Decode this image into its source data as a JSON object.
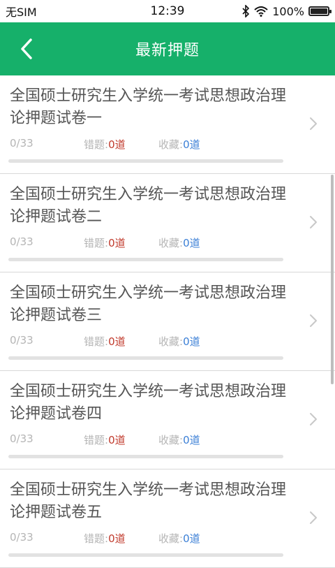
{
  "status_bar": {
    "carrier": "无SIM",
    "time": "12:39",
    "battery": "100%"
  },
  "header": {
    "title": "最新押题"
  },
  "exams": [
    {
      "title": "全国硕士研究生入学统一考试思想政治理论押题试卷一",
      "progress": "0/33",
      "progress_fraction": 0,
      "wrong_label": "错题:",
      "wrong_count": "0道",
      "fav_label": "收藏:",
      "fav_count": "0道"
    },
    {
      "title": "全国硕士研究生入学统一考试思想政治理论押题试卷二",
      "progress": "0/33",
      "progress_fraction": 0,
      "wrong_label": "错题:",
      "wrong_count": "0道",
      "fav_label": "收藏:",
      "fav_count": "0道"
    },
    {
      "title": "全国硕士研究生入学统一考试思想政治理论押题试卷三",
      "progress": "0/33",
      "progress_fraction": 0,
      "wrong_label": "错题:",
      "wrong_count": "0道",
      "fav_label": "收藏:",
      "fav_count": "0道"
    },
    {
      "title": "全国硕士研究生入学统一考试思想政治理论押题试卷四",
      "progress": "0/33",
      "progress_fraction": 0,
      "wrong_label": "错题:",
      "wrong_count": "0道",
      "fav_label": "收藏:",
      "fav_count": "0道"
    },
    {
      "title": "全国硕士研究生入学统一考试思想政治理论押题试卷五",
      "progress": "0/33",
      "progress_fraction": 0,
      "wrong_label": "错题:",
      "wrong_count": "0道",
      "fav_label": "收藏:",
      "fav_count": "0道"
    }
  ],
  "colors": {
    "header_bg": "#16b06a",
    "wrong_count": "#c0392b",
    "fav_count": "#3b7fd6"
  },
  "icons": {
    "back": "chevron-left-icon",
    "item_arrow": "chevron-right-icon",
    "bluetooth": "bluetooth-icon",
    "wifi": "wifi-icon",
    "battery": "battery-icon"
  }
}
